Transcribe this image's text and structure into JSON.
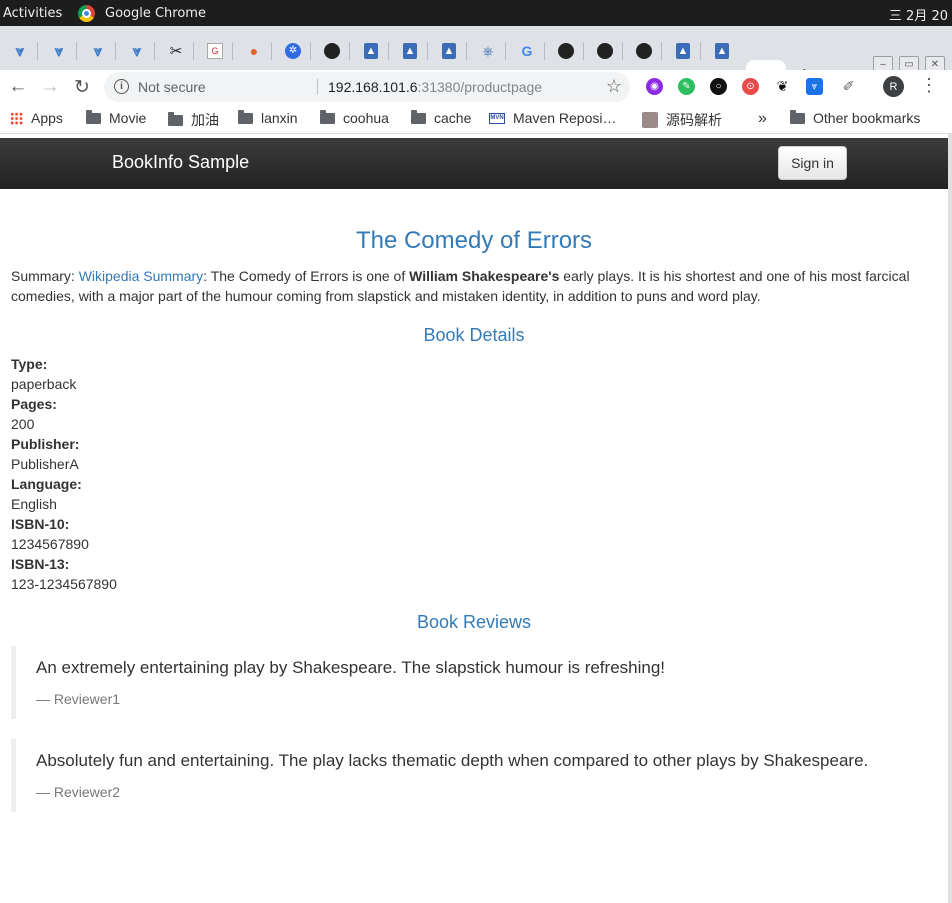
{
  "os": {
    "activities": "Activities",
    "app_name": "Google Chrome",
    "clock": "三 2月 20"
  },
  "browser": {
    "active_tab_fragment": "S",
    "url_host": "192.168.101.6",
    "url_rest": ":31380/productpage",
    "security_label": "Not secure",
    "profile_initial": "R"
  },
  "bookmarks": [
    {
      "label": "Apps",
      "icon": "apps-icon"
    },
    {
      "label": "Movie",
      "icon": "folder-icon"
    },
    {
      "label": "加油",
      "icon": "folder-icon"
    },
    {
      "label": "lanxin",
      "icon": "folder-icon"
    },
    {
      "label": "coohua",
      "icon": "folder-icon"
    },
    {
      "label": "cache",
      "icon": "folder-icon"
    },
    {
      "label": "Maven Reposi…",
      "icon": "maven-icon"
    },
    {
      "label": "源码解析",
      "icon": "image-icon"
    },
    {
      "label": "Other bookmarks",
      "icon": "folder-icon"
    }
  ],
  "page": {
    "brand": "BookInfo Sample",
    "signin_label": "Sign in",
    "title": "The Comedy of Errors",
    "summary_prefix": "Summary: ",
    "summary_link": "Wikipedia Summary",
    "summary_text_1": ": The Comedy of Errors is one of ",
    "summary_bold": "William Shakespeare's",
    "summary_text_2": " early plays. It is his shortest and one of his most farcical comedies, with a major part of the humour coming from slapstick and mistaken identity, in addition to puns and word play.",
    "details_heading": "Book Details",
    "details": [
      {
        "label": "Type:",
        "value": "paperback"
      },
      {
        "label": "Pages:",
        "value": "200"
      },
      {
        "label": "Publisher:",
        "value": "PublisherA"
      },
      {
        "label": "Language:",
        "value": "English"
      },
      {
        "label": "ISBN-10:",
        "value": "1234567890"
      },
      {
        "label": "ISBN-13:",
        "value": "123-1234567890"
      }
    ],
    "reviews_heading": "Book Reviews",
    "reviews": [
      {
        "text": "An extremely entertaining play by Shakespeare. The slapstick humour is refreshing!",
        "author": "— Reviewer1"
      },
      {
        "text": "Absolutely fun and entertaining. The play lacks thematic depth when compared to other plays by Shakespeare.",
        "author": "— Reviewer2"
      }
    ]
  }
}
